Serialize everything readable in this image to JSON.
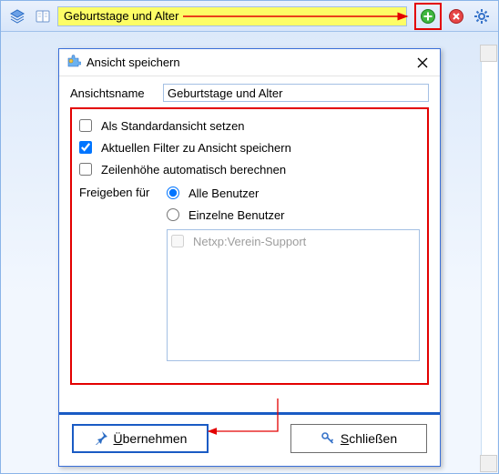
{
  "toolbar": {
    "input_value": "Geburtstage und Alter",
    "icons": {
      "stack": "stack-icon",
      "book": "book-icon",
      "add": "add-icon",
      "cancel": "cancel-icon",
      "gear": "gear-icon"
    }
  },
  "dialog": {
    "title": "Ansicht speichern",
    "name_label": "Ansichtsname",
    "name_value": "Geburtstage und Alter",
    "cb_default": "Als Standardansicht setzen",
    "cb_default_checked": false,
    "cb_savefilter": "Aktuellen Filter zu Ansicht speichern",
    "cb_savefilter_checked": true,
    "cb_rowheight": "Zeilenhöhe automatisch berechnen",
    "cb_rowheight_checked": false,
    "share_label": "Freigeben für",
    "share_all": "Alle Benutzer",
    "share_single": "Einzelne Benutzer",
    "share_selected": "all",
    "user_list": [
      {
        "label": "Netxp:Verein-Support",
        "checked": false
      }
    ],
    "accept_prefix": "Ü",
    "accept_rest": "bernehmen",
    "close_prefix": "S",
    "close_rest": "chließen"
  },
  "colors": {
    "highlight_yellow": "#fdfd66",
    "annotation_red": "#e30000",
    "accent_blue": "#1a5bc4",
    "add_green": "#2fa62f"
  }
}
